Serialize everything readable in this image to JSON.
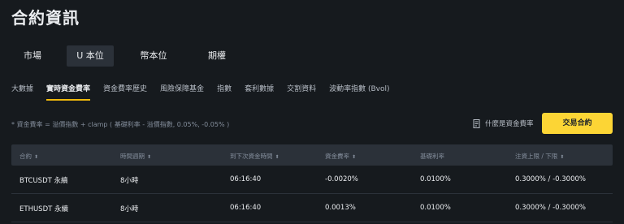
{
  "page": {
    "title": "合約資訊"
  },
  "segments": [
    {
      "label": "市場",
      "active": false
    },
    {
      "label": "U 本位",
      "active": true
    },
    {
      "label": "幣本位",
      "active": false
    },
    {
      "label": "期權",
      "active": false
    }
  ],
  "tabs": [
    {
      "label": "大數據",
      "active": false
    },
    {
      "label": "實時資金費率",
      "active": true
    },
    {
      "label": "資金費率歷史",
      "active": false
    },
    {
      "label": "風險保障基金",
      "active": false
    },
    {
      "label": "指數",
      "active": false
    },
    {
      "label": "套利數據",
      "active": false
    },
    {
      "label": "交割資料",
      "active": false
    },
    {
      "label": "波動率指數 (Bvol)",
      "active": false
    }
  ],
  "formula": "* 資金費率 = 溢價指數 + clamp ( 基礎利率 - 溢價指數, 0.05%, -0.05% )",
  "help_link": {
    "label": "什麼是資金費率",
    "icon": "document-icon"
  },
  "trade_button": {
    "label": "交易合約"
  },
  "table": {
    "headers": [
      "合約",
      "時間週期",
      "到下次資金時間",
      "資金費率",
      "基礎利率",
      "注資上限 / 下限"
    ],
    "sortable": [
      true,
      true,
      true,
      true,
      false,
      true
    ],
    "rows": [
      [
        "BTCUSDT 永續",
        "8小時",
        "06:16:40",
        "-0.0020%",
        "0.0100%",
        "0.3000% / -0.3000%"
      ],
      [
        "ETHUSDT 永續",
        "8小時",
        "06:16:40",
        "0.0013%",
        "0.0100%",
        "0.3000% / -0.3000%"
      ]
    ]
  },
  "colors": {
    "accent": "#fcd535",
    "background": "#161a1e",
    "header_bg": "#2b3139"
  }
}
